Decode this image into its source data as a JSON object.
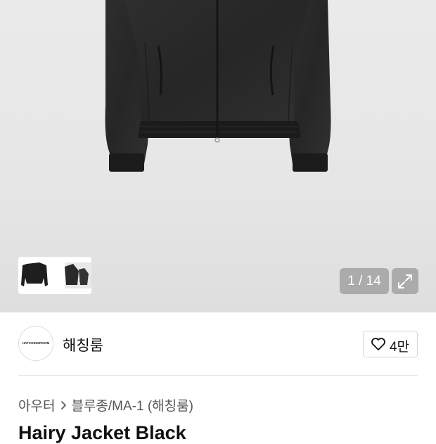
{
  "gallery": {
    "counter": "1 / 14"
  },
  "brand": {
    "logo_text": "HATCHINGROOM",
    "name": "해칭룸",
    "like_count": "4만"
  },
  "breadcrumb": {
    "category": "아우터",
    "subcategory": "블루종/MA-1 (해칭룸)"
  },
  "product": {
    "title": "Hairy Jacket Black"
  },
  "icons": {
    "thumb_next": "chevron-right-icon",
    "expand": "expand-icon",
    "like": "heart-icon",
    "breadcrumb_sep": "chevron-right-icon"
  },
  "colors": {
    "jacket": "#2a2a2a",
    "overlay": "#8a8a8a"
  }
}
